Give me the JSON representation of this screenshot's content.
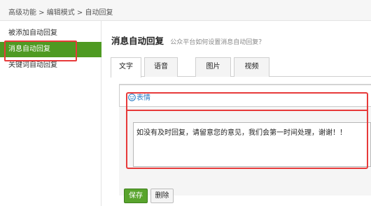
{
  "breadcrumb": {
    "text": "高级功能 > 编辑模式 > 自动回复"
  },
  "sidebar": {
    "items": [
      {
        "label": "被添加自动回复"
      },
      {
        "label": "消息自动回复"
      },
      {
        "label": "关键词自动回复"
      }
    ],
    "active_index": 1
  },
  "header": {
    "title": "消息自动回复",
    "subtitle": "公众平台如何设置消息自动回复？"
  },
  "tabs": [
    {
      "label": "文字"
    },
    {
      "label": "语音"
    },
    {
      "label": "图片"
    },
    {
      "label": "视频"
    }
  ],
  "editor": {
    "emoji_label": "表情",
    "content": "如没有及时回复，请留意您的意见，我们会第一时间处理，谢谢！！"
  },
  "actions": {
    "save_label": "保存",
    "delete_label": "删除"
  },
  "colors": {
    "active_green": "#4e9a22",
    "highlight_red": "#e73a3a",
    "link_blue": "#2b7dc6"
  }
}
